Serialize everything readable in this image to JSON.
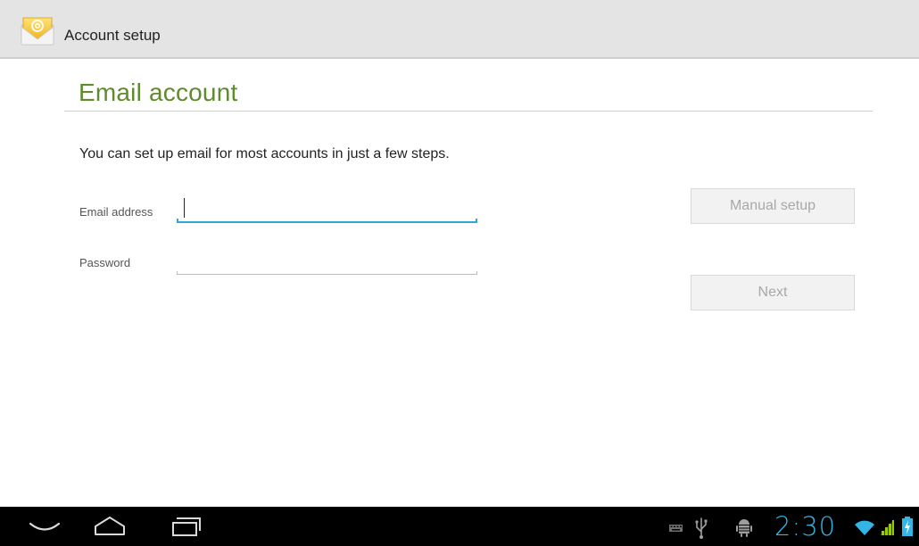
{
  "app": {
    "title": "Account setup",
    "icon": "email-app-icon",
    "accent_color": "#5f8a2e"
  },
  "page": {
    "heading": "Email account",
    "intro": "You can set up email for most accounts in just a few steps."
  },
  "form": {
    "email": {
      "label": "Email address",
      "value": "",
      "focused": true
    },
    "password": {
      "label": "Password",
      "value": ""
    }
  },
  "buttons": {
    "manual_setup": "Manual setup",
    "next": "Next",
    "disabled_color": "#a8a8a8"
  },
  "system_bar": {
    "nav": [
      "back-icon",
      "home-icon",
      "recent-apps-icon"
    ],
    "status_icons": [
      "keyboard-icon",
      "usb-icon",
      "android-debug-icon",
      "wifi-icon",
      "signal-icon",
      "battery-charging-icon"
    ],
    "clock": "2:30",
    "clock_color": "#33b5e5"
  }
}
